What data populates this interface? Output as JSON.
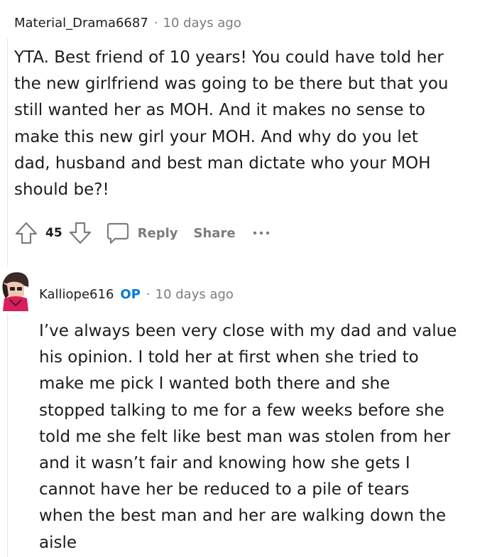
{
  "comments": [
    {
      "author": "Material_Drama6687",
      "separator": "·",
      "time": "10 days ago",
      "body_lines": [
        "YTA. Best friend of 10 years! You could have told her",
        "the new girlfriend was going to be there but that you",
        "still wanted her as MOH. And it makes no sense to",
        "make this new girl your MOH. And why do you let",
        "dad, husband and best man dictate who your MOH",
        "should be?!"
      ],
      "score": "45",
      "actions": {
        "reply": "Reply",
        "share": "Share",
        "more": "···"
      }
    },
    {
      "author": "Kalliope616",
      "badge": "OP",
      "separator": "·",
      "time": "10 days ago",
      "body_lines": [
        "I’ve always been very close with my dad and value",
        "his opinion. I told her at first when she tried to",
        "make me pick I wanted both there and she",
        "stopped talking to me for a few weeks before she",
        "told me she felt like best man was stolen from her",
        "and it wasn’t fair and knowing how she gets I",
        "cannot have her be reduced to a pile of tears",
        "when the best man and her are walking down the",
        "aisle"
      ]
    }
  ],
  "colors": {
    "text": "#1c1c1c",
    "meta": "#7c7c7c",
    "op_badge": "#0079d3",
    "thread_line": "#e6e6e6"
  },
  "icons": {
    "upvote": "upvote-arrow-icon",
    "downvote": "downvote-arrow-icon",
    "reply": "speech-bubble-icon",
    "more": "ellipsis-icon",
    "avatar": "user-avatar"
  }
}
